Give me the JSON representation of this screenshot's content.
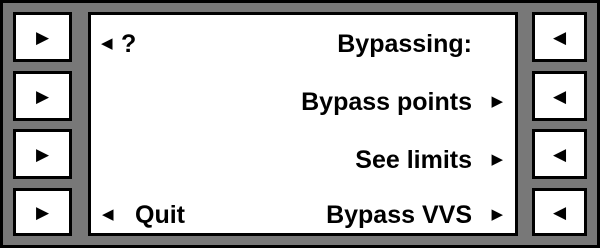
{
  "softkeys": {
    "left_glyph": "▶",
    "right_glyph": "◀"
  },
  "display": {
    "line1": {
      "left_arrow": "◀",
      "help": "?",
      "title": "Bypassing:"
    },
    "line2": {
      "label": "Bypass points",
      "arrow": "▶"
    },
    "line3": {
      "label": "See limits",
      "arrow": "▶"
    },
    "line4": {
      "left_arrow": "◀",
      "quit": "Quit",
      "label": "Bypass VVS",
      "arrow": "▶"
    }
  },
  "colors": {
    "bezel": "#787878",
    "screen": "#ffffff",
    "border": "#000000"
  }
}
